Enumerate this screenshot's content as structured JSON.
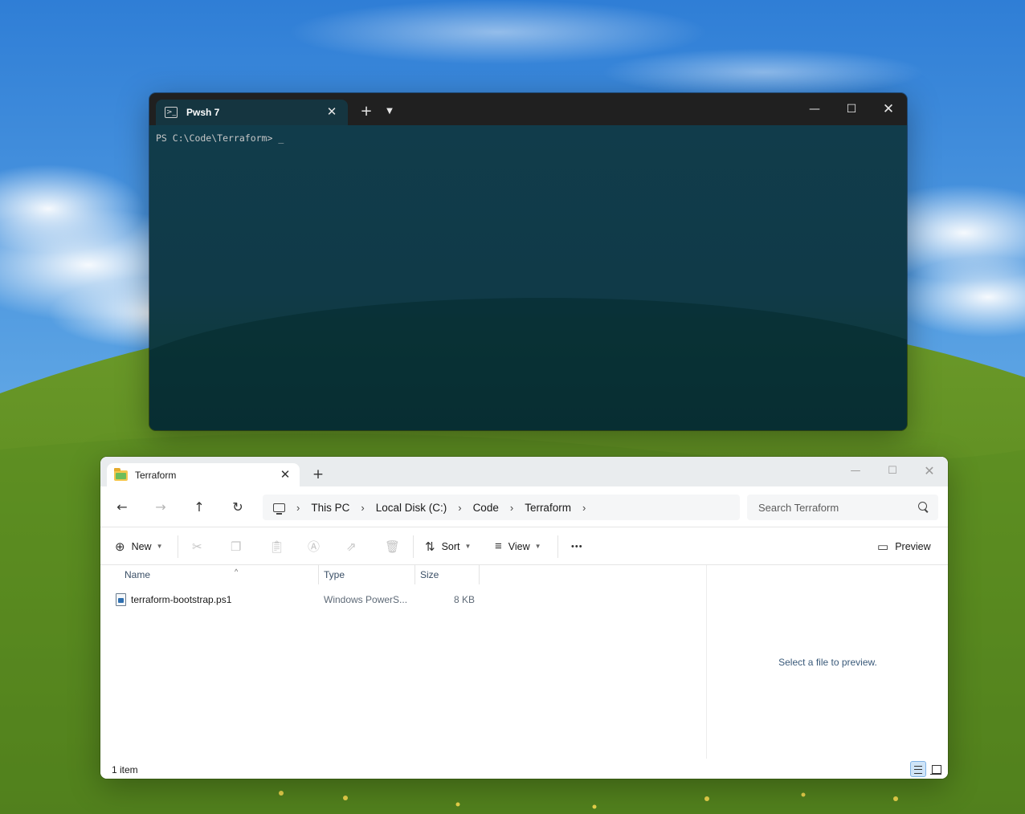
{
  "terminal": {
    "tab_title": "Pwsh 7",
    "tab_icon": "powershell-icon",
    "new_tab": "+",
    "dropdown": "⌄",
    "prompt": "PS C:\\Code\\Terraform> _",
    "controls": {
      "minimize": "—",
      "maximize": "☐",
      "close": "✕"
    }
  },
  "explorer": {
    "tab_title": "Terraform",
    "tab_icon": "folder-icon",
    "new_tab": "+",
    "controls": {
      "minimize": "—",
      "maximize": "☐",
      "close": "✕"
    },
    "nav": {
      "back": "←",
      "forward": "→",
      "up": "↑",
      "refresh": "↻"
    },
    "breadcrumb": [
      "This PC",
      "Local Disk (C:)",
      "Code",
      "Terraform"
    ],
    "search_placeholder": "Search Terraform",
    "toolbar": {
      "new_label": "New",
      "sort_label": "Sort",
      "view_label": "View",
      "more_label": "•••",
      "preview_label": "Preview"
    },
    "columns": [
      "Name",
      "Type",
      "Size"
    ],
    "files": [
      {
        "name": "terraform-bootstrap.ps1",
        "type": "Windows PowerS...",
        "size": "8 KB"
      }
    ],
    "preview_message": "Select a file to preview.",
    "status": "1 item"
  }
}
